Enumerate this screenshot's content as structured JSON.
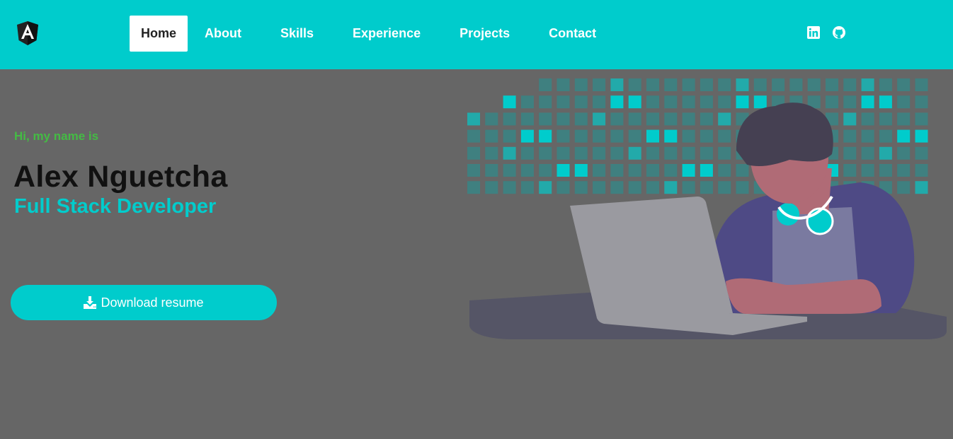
{
  "navbar": {
    "logo_icon": "angular-logo-icon",
    "links": [
      {
        "label": "Home",
        "active": true
      },
      {
        "label": "About"
      },
      {
        "label": "Skills"
      },
      {
        "label": "Experience"
      },
      {
        "label": "Projects"
      },
      {
        "label": "Contact"
      }
    ],
    "social_icons": [
      "linkedin-icon",
      "github-icon"
    ]
  },
  "hero": {
    "greeting": "Hi, my name is",
    "name": "Alex Nguetcha",
    "role": "Full Stack Developer",
    "download_label": "Download resume",
    "download_icon": "download-icon",
    "illustration": "developer-with-laptop-illustration"
  },
  "colors": {
    "primary": "#00cccc",
    "background": "#666666",
    "greeting": "#44bb44",
    "name": "#111111"
  }
}
